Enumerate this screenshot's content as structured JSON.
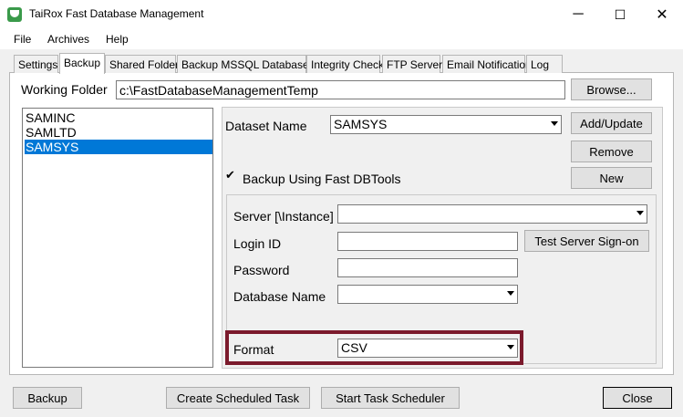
{
  "window": {
    "title": "TaiRox Fast Database Management",
    "minimize": "─",
    "maximize": "☐",
    "close": "✕"
  },
  "menu": [
    {
      "label": "File"
    },
    {
      "label": "Archives"
    },
    {
      "label": "Help"
    }
  ],
  "tabs": [
    {
      "label": "Settings"
    },
    {
      "label": "Backup"
    },
    {
      "label": "Shared Folder"
    },
    {
      "label": "Backup MSSQL Databases"
    },
    {
      "label": "Integrity Check"
    },
    {
      "label": "FTP Server"
    },
    {
      "label": "Email Notification"
    },
    {
      "label": "Log"
    }
  ],
  "working_folder": {
    "label": "Working Folder",
    "value": "c:\\FastDatabaseManagementTemp",
    "browse": "Browse..."
  },
  "datasets": [
    "SAMINC",
    "SAMLTD",
    "SAMSYS"
  ],
  "selected_dataset": "SAMSYS",
  "dataset_name": {
    "label": "Dataset Name",
    "value": "SAMSYS"
  },
  "buttons": {
    "add_update": "Add/Update",
    "remove": "Remove",
    "new": "New",
    "test_server": "Test Server Sign-on"
  },
  "backup_fast": {
    "label": "Backup Using Fast DBTools",
    "checked": true,
    "checkmark": "✔"
  },
  "server": {
    "label": "Server [\\Instance]",
    "value": ""
  },
  "login": {
    "label": "Login ID",
    "value": ""
  },
  "password": {
    "label": "Password",
    "value": ""
  },
  "database": {
    "label": "Database Name",
    "value": ""
  },
  "format": {
    "label": "Format",
    "value": "CSV"
  },
  "bottom": {
    "backup": "Backup",
    "create_task": "Create Scheduled Task",
    "start_scheduler": "Start Task Scheduler",
    "close": "Close"
  },
  "colors": {
    "selection": "#0078d7",
    "highlight_border": "#7b1a2c"
  }
}
